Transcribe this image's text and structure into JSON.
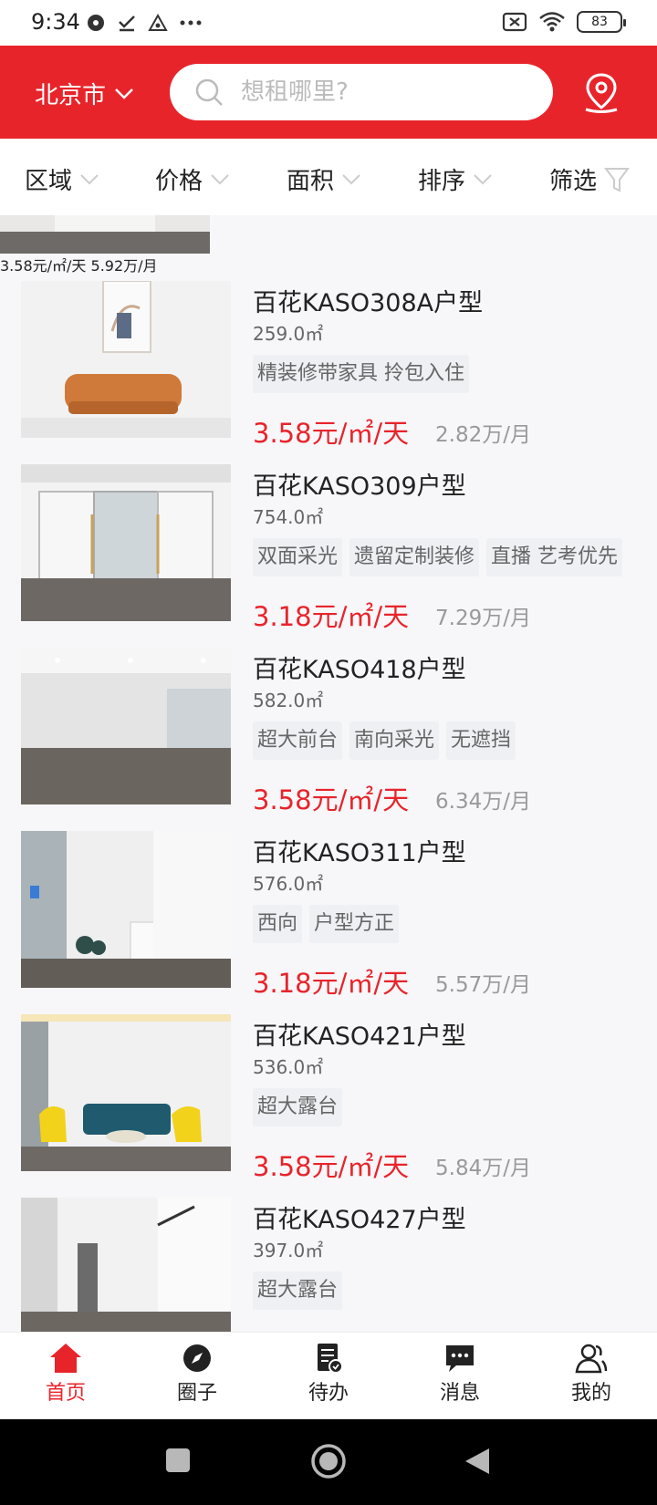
{
  "status_bar": {
    "time": "9:34",
    "battery": "83"
  },
  "header": {
    "city": "北京市",
    "search_placeholder": "想租哪里?"
  },
  "filters": [
    {
      "label": "区域"
    },
    {
      "label": "价格"
    },
    {
      "label": "面积"
    },
    {
      "label": "排序"
    },
    {
      "label": "筛选"
    }
  ],
  "partial_listing": {
    "price": "3.58元/㎡/天",
    "monthly": "5.92万/月"
  },
  "listings": [
    {
      "title": "百花KASO308A户型",
      "area": "259.0㎡",
      "tags": [
        "精装修带家具 拎包入住"
      ],
      "price": "3.58元/㎡/天",
      "monthly": "2.82万/月"
    },
    {
      "title": "百花KASO309户型",
      "area": "754.0㎡",
      "tags": [
        "双面采光",
        "遗留定制装修",
        "直播 艺考优先"
      ],
      "price": "3.18元/㎡/天",
      "monthly": "7.29万/月"
    },
    {
      "title": "百花KASO418户型",
      "area": "582.0㎡",
      "tags": [
        "超大前台",
        "南向采光",
        "无遮挡"
      ],
      "price": "3.58元/㎡/天",
      "monthly": "6.34万/月"
    },
    {
      "title": "百花KASO311户型",
      "area": "576.0㎡",
      "tags": [
        "西向",
        "户型方正"
      ],
      "price": "3.18元/㎡/天",
      "monthly": "5.57万/月"
    },
    {
      "title": "百花KASO421户型",
      "area": "536.0㎡",
      "tags": [
        "超大露台"
      ],
      "price": "3.58元/㎡/天",
      "monthly": "5.84万/月"
    },
    {
      "title": "百花KASO427户型",
      "area": "397.0㎡",
      "tags": [
        "超大露台"
      ]
    }
  ],
  "bottom_nav": [
    {
      "label": "首页",
      "icon": "home-icon",
      "active": true
    },
    {
      "label": "圈子",
      "icon": "compass-icon",
      "active": false
    },
    {
      "label": "待办",
      "icon": "todo-icon",
      "active": false
    },
    {
      "label": "消息",
      "icon": "message-icon",
      "active": false
    },
    {
      "label": "我的",
      "icon": "profile-icon",
      "active": false
    }
  ],
  "colors": {
    "brand_red": "#e8242b",
    "tag_bg": "#eef0f4"
  }
}
